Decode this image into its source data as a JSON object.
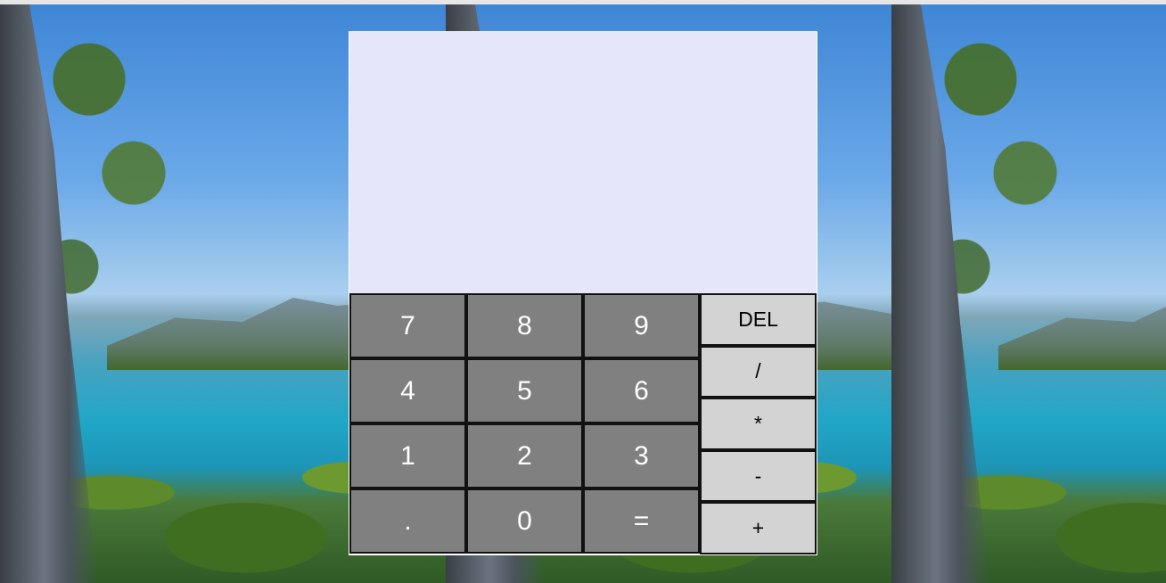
{
  "calculator": {
    "display_value": "",
    "digit_rows": [
      [
        "7",
        "8",
        "9"
      ],
      [
        "4",
        "5",
        "6"
      ],
      [
        "1",
        "2",
        "3"
      ],
      [
        ".",
        "0",
        "="
      ]
    ],
    "operators": [
      "DEL",
      "/",
      "*",
      "-",
      "+"
    ]
  },
  "colors": {
    "screen_bg": "#e6e6fa",
    "digit_button_bg": "#808080",
    "digit_button_text": "#ffffff",
    "operator_button_bg": "#d3d3d3",
    "operator_button_text": "#000000"
  },
  "background": {
    "image": "lakeside-landscape-with-trees-and-mountains"
  }
}
